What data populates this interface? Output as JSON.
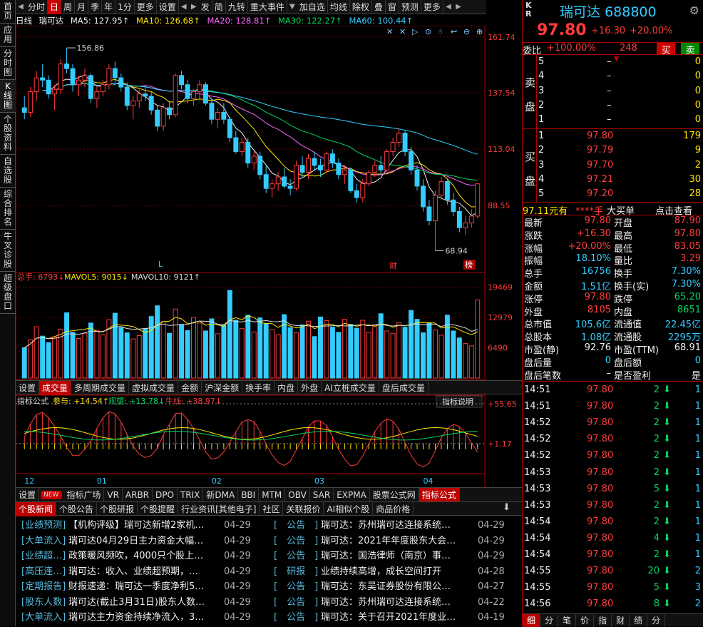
{
  "vtabs": [
    "首页",
    "应用",
    "分时图",
    "K线图",
    "个股资料",
    "自选股",
    "综合排名",
    "牛叉诊股",
    "超级盘口"
  ],
  "toolbar": {
    "items": [
      "分时",
      "日",
      "周",
      "月",
      "季",
      "年",
      "1分",
      "更多",
      "设置",
      "发",
      "简",
      "九转",
      "重大事件",
      "加自选",
      "均线",
      "除权",
      "叠",
      "窗",
      "预测",
      "更多"
    ],
    "active": "日"
  },
  "ma_line": {
    "period": "日线",
    "name": "瑞可达",
    "ma5": "MA5: 127.95↑",
    "ma10": "MA10: 126.68↑",
    "ma20": "MA20: 128.81↑",
    "ma30": "MA30: 122.27↑",
    "ma60": "MA60: 100.44↑"
  },
  "price_axis": [
    "161.74",
    "137.54",
    "113.04",
    "88.55"
  ],
  "annot": {
    "high": "156.86",
    "low": "68.94",
    "l_mark": "L",
    "cai": "财",
    "bang": "榜"
  },
  "vol_line": {
    "total": "总手: 6793↓",
    "mavol5": "MAVOL5: 9015↓",
    "mavol10": "MAVOL10: 9121↑"
  },
  "vol_axis": [
    "19469",
    "12979",
    "6490"
  ],
  "vol_tabs": [
    "设置",
    "成交量",
    "多周期成交量",
    "虚拟成交量",
    "金额",
    "沪深金额",
    "换手率",
    "内盘",
    "外盘",
    "AI立桩成交量",
    "盘后成交量"
  ],
  "vol_tab_active": "成交量",
  "ind_line": {
    "name": "指标公式",
    "a": "参与: +14.54↑",
    "b": "观望: +13.78↓",
    "c": "牛线: +38.97↓"
  },
  "ind_axis": [
    "+55.65",
    "+1.17"
  ],
  "ind_help": "指标说明",
  "months": [
    "12",
    "01",
    "02",
    "03",
    "04"
  ],
  "ind_tabs": [
    "设置",
    "NEW",
    "指标广场",
    "VR",
    "ARBR",
    "DPO",
    "TRIX",
    "新DMA",
    "BBI",
    "MTM",
    "OBV",
    "SAR",
    "EXPMA",
    "股票公式网",
    "指标公式"
  ],
  "ind_tab_active": "指标公式",
  "news_tabs": [
    "个股新闻",
    "个股公告",
    "个股研报",
    "个股提醒",
    "行业资讯[其他电子]",
    "社区",
    "关联报价",
    "AI相似个股",
    "商品价格"
  ],
  "news_left": [
    {
      "tag": "[业绩预测]",
      "title": "【机构评级】瑞可达新增2家机…",
      "date": "04-29"
    },
    {
      "tag": "[大单流入]",
      "title": "瑞可达04月29日主力资金大幅…",
      "date": "04-29"
    },
    {
      "tag": "[业绩超…]",
      "title": "政策暖风频吹，4000只个股上…",
      "date": "04-29"
    },
    {
      "tag": "[高压连…]",
      "title": "瑞可达：收入、业绩超预期，…",
      "date": "04-29"
    },
    {
      "tag": "[定期报告]",
      "title": "财报速递：瑞可达一季度净利5…",
      "date": "04-29"
    },
    {
      "tag": "[股东人数]",
      "title": "瑞可达(截止3月31日)股东人数…",
      "date": "04-29"
    },
    {
      "tag": "[大单流入]",
      "title": "瑞可达主力资金持续净流入，3…",
      "date": "04-29"
    }
  ],
  "news_right": [
    {
      "tag": "[　公告　]",
      "title": "瑞可达：苏州瑞可达连接系统…",
      "date": "04-29"
    },
    {
      "tag": "[　公告　]",
      "title": "瑞可达：2021年年度股东大会…",
      "date": "04-29"
    },
    {
      "tag": "[　公告　]",
      "title": "瑞可达：国浩律师（南京）事…",
      "date": "04-29"
    },
    {
      "tag": "[　研报　]",
      "title": "业绩持续高增，成长空间打开",
      "date": "04-28"
    },
    {
      "tag": "[　公告　]",
      "title": "瑞可达：东吴证券股份有限公…",
      "date": "04-27"
    },
    {
      "tag": "[　公告　]",
      "title": "瑞可达：苏州瑞可达连接系统…",
      "date": "04-22"
    },
    {
      "tag": "[　公告　]",
      "title": "瑞可达：关于召开2021年度业…",
      "date": "04-19"
    }
  ],
  "quote": {
    "kr": "K",
    "kr2": "R",
    "name": "瑞可达",
    "code": "688800",
    "price": "97.80",
    "change": "+16.30",
    "pct": "+20.00%",
    "weibi_label": "委比",
    "weibi": "+100.00%",
    "weicha": "248",
    "buy": "买",
    "sell": "卖"
  },
  "asks": [
    {
      "lvl": "5",
      "p": "–",
      "v": "0"
    },
    {
      "lvl": "4",
      "p": "–",
      "v": "0"
    },
    {
      "lvl": "3",
      "p": "–",
      "v": "0"
    },
    {
      "lvl": "2",
      "p": "–",
      "v": "0"
    },
    {
      "lvl": "1",
      "p": "–",
      "v": "0"
    }
  ],
  "bids": [
    {
      "lvl": "1",
      "p": "97.80",
      "v": "179"
    },
    {
      "lvl": "2",
      "p": "97.79",
      "v": "9"
    },
    {
      "lvl": "3",
      "p": "97.70",
      "v": "2"
    },
    {
      "lvl": "4",
      "p": "97.21",
      "v": "30"
    },
    {
      "lvl": "5",
      "p": "97.20",
      "v": "28"
    }
  ],
  "ask_label": [
    "卖",
    "盘"
  ],
  "bid_label": [
    "买",
    "盘"
  ],
  "bigorder": {
    "a": "97.11元有",
    "b": "****手",
    "c": "大买单",
    "d": "点击查看"
  },
  "stats": [
    [
      "最新",
      "97.80",
      "red",
      "开盘",
      "87.90",
      "red"
    ],
    [
      "涨跌",
      "+16.30",
      "red",
      "最高",
      "97.80",
      "red"
    ],
    [
      "涨幅",
      "+20.00%",
      "red",
      "最低",
      "83.05",
      "red"
    ],
    [
      "振幅",
      "18.10%",
      "cyn",
      "量比",
      "3.29",
      "red"
    ],
    [
      "总手",
      "16756",
      "cyn",
      "换手",
      "7.30%",
      "cyn"
    ],
    [
      "金额",
      "1.51亿",
      "cyn",
      "换手(实)",
      "7.30%",
      "cyn"
    ],
    [
      "涨停",
      "97.80",
      "red",
      "跌停",
      "65.20",
      "grn"
    ],
    [
      "外盘",
      "8105",
      "red",
      "内盘",
      "8651",
      "grn"
    ],
    [
      "总市值",
      "105.6亿",
      "cyn",
      "流通值",
      "22.45亿",
      "cyn"
    ],
    [
      "总股本",
      "1.08亿",
      "cyn",
      "流通股",
      "2295万",
      "cyn"
    ],
    [
      "市盈(静)",
      "92.76",
      "wht",
      "市盈(TTM)",
      "68.91",
      "wht"
    ],
    [
      "盘后量",
      "0",
      "cyn",
      "盘后额",
      "0",
      "cyn"
    ],
    [
      "盘后笔数",
      "–",
      "wht",
      "是否盈利",
      "是",
      "wht"
    ]
  ],
  "ticks": [
    [
      "14:51",
      "97.80",
      "2",
      "1"
    ],
    [
      "14:51",
      "97.80",
      "2",
      "1"
    ],
    [
      "14:52",
      "97.80",
      "2",
      "1"
    ],
    [
      "14:52",
      "97.80",
      "2",
      "1"
    ],
    [
      "14:52",
      "97.80",
      "2",
      "1"
    ],
    [
      "14:53",
      "97.80",
      "2",
      "1"
    ],
    [
      "14:53",
      "97.80",
      "5",
      "1"
    ],
    [
      "14:53",
      "97.80",
      "2",
      "1"
    ],
    [
      "14:54",
      "97.80",
      "2",
      "1"
    ],
    [
      "14:54",
      "97.80",
      "4",
      "1"
    ],
    [
      "14:54",
      "97.80",
      "2",
      "1"
    ],
    [
      "14:55",
      "97.80",
      "20",
      "2"
    ],
    [
      "14:55",
      "97.80",
      "5",
      "3"
    ],
    [
      "14:56",
      "97.80",
      "8",
      "2"
    ]
  ],
  "bottom_tabs": [
    "细",
    "分",
    "笔",
    "价",
    "指",
    "财",
    "绩",
    "分"
  ],
  "colors": {
    "up": "#ff3b3b",
    "down": "#3cf",
    "bg": "#000"
  },
  "chart_data": {
    "type": "candlestick",
    "title": "瑞可达 日线",
    "ylim": [
      62,
      166
    ],
    "candles": [
      [
        131,
        136,
        126,
        129
      ],
      [
        129,
        140,
        127,
        138
      ],
      [
        138,
        147,
        134,
        144
      ],
      [
        144,
        150,
        140,
        143
      ],
      [
        143,
        145,
        135,
        137
      ],
      [
        137,
        141,
        130,
        139
      ],
      [
        139,
        152,
        137,
        150
      ],
      [
        150,
        157,
        146,
        148
      ],
      [
        148,
        150,
        138,
        141
      ],
      [
        141,
        145,
        136,
        143
      ],
      [
        143,
        148,
        140,
        145
      ],
      [
        145,
        146,
        133,
        135
      ],
      [
        135,
        140,
        131,
        138
      ],
      [
        138,
        143,
        136,
        141
      ],
      [
        141,
        150,
        139,
        148
      ],
      [
        148,
        151,
        142,
        144
      ],
      [
        144,
        146,
        138,
        140
      ],
      [
        140,
        142,
        130,
        132
      ],
      [
        132,
        136,
        126,
        134
      ],
      [
        134,
        139,
        131,
        137
      ],
      [
        137,
        141,
        134,
        136
      ],
      [
        136,
        138,
        128,
        130
      ],
      [
        130,
        132,
        121,
        123
      ],
      [
        123,
        133,
        121,
        131
      ],
      [
        131,
        134,
        126,
        128
      ],
      [
        128,
        146,
        127,
        145
      ],
      [
        145,
        147,
        139,
        141
      ],
      [
        141,
        143,
        133,
        135
      ],
      [
        135,
        139,
        132,
        138
      ],
      [
        138,
        143,
        134,
        141
      ],
      [
        141,
        142,
        132,
        133
      ],
      [
        133,
        135,
        124,
        126
      ],
      [
        126,
        131,
        122,
        129
      ],
      [
        129,
        133,
        124,
        126
      ],
      [
        126,
        127,
        116,
        118
      ],
      [
        118,
        121,
        111,
        112
      ],
      [
        112,
        118,
        110,
        116
      ],
      [
        116,
        118,
        105,
        107
      ],
      [
        107,
        112,
        104,
        110
      ],
      [
        110,
        112,
        100,
        102
      ],
      [
        102,
        106,
        94,
        96
      ],
      [
        96,
        100,
        92,
        98
      ],
      [
        98,
        103,
        95,
        101
      ],
      [
        101,
        105,
        96,
        97
      ],
      [
        97,
        100,
        93,
        96
      ],
      [
        96,
        108,
        95,
        106
      ],
      [
        106,
        110,
        101,
        103
      ],
      [
        103,
        111,
        100,
        109
      ],
      [
        109,
        112,
        104,
        106
      ],
      [
        106,
        109,
        101,
        104
      ],
      [
        104,
        112,
        103,
        111
      ],
      [
        111,
        113,
        105,
        107
      ],
      [
        107,
        109,
        100,
        102
      ],
      [
        102,
        106,
        98,
        104
      ],
      [
        104,
        105,
        94,
        95
      ],
      [
        95,
        98,
        90,
        92
      ],
      [
        92,
        100,
        90,
        98
      ],
      [
        98,
        104,
        97,
        103
      ],
      [
        103,
        108,
        101,
        106
      ],
      [
        106,
        110,
        102,
        104
      ],
      [
        104,
        113,
        103,
        112
      ],
      [
        112,
        118,
        110,
        116
      ],
      [
        116,
        122,
        114,
        120
      ],
      [
        120,
        121,
        110,
        112
      ],
      [
        112,
        114,
        102,
        104
      ],
      [
        104,
        106,
        95,
        97
      ],
      [
        97,
        100,
        86,
        88
      ],
      [
        88,
        91,
        80,
        82
      ],
      [
        82,
        95,
        69,
        93
      ],
      [
        93,
        101,
        91,
        99
      ],
      [
        99,
        100,
        89,
        91
      ],
      [
        91,
        94,
        84,
        86
      ],
      [
        86,
        88,
        77,
        79
      ],
      [
        79,
        84,
        76,
        81
      ],
      [
        81,
        87,
        79,
        84
      ],
      [
        84,
        98,
        83,
        98
      ]
    ],
    "volume": [
      6500,
      8200,
      11000,
      9000,
      7600,
      8800,
      10500,
      14000,
      9800,
      8500,
      9600,
      11800,
      10200,
      9300,
      12500,
      13900,
      10800,
      9700,
      8400,
      9100,
      10600,
      13200,
      15500,
      12100,
      9600,
      14800,
      11500,
      10200,
      13000,
      11800,
      10100,
      12700,
      9500,
      11300,
      18800,
      12400,
      10600,
      13500,
      9900,
      12900,
      11700,
      10400,
      9300,
      13600,
      10800,
      9700,
      11400,
      12200,
      8900,
      13100,
      12300,
      10900,
      9800,
      12600,
      11500,
      10700,
      12400,
      9800,
      11200,
      13800,
      10100,
      9600,
      11900,
      10900,
      14500,
      12600,
      9700,
      11800,
      10300,
      9200,
      13500,
      10100,
      8600,
      7400,
      6900,
      16756
    ],
    "indicator": {
      "series": [
        "参与",
        "观望",
        "牛线"
      ],
      "last": [
        14.54,
        13.78,
        38.97
      ],
      "range": [
        -40,
        55.65
      ]
    }
  }
}
